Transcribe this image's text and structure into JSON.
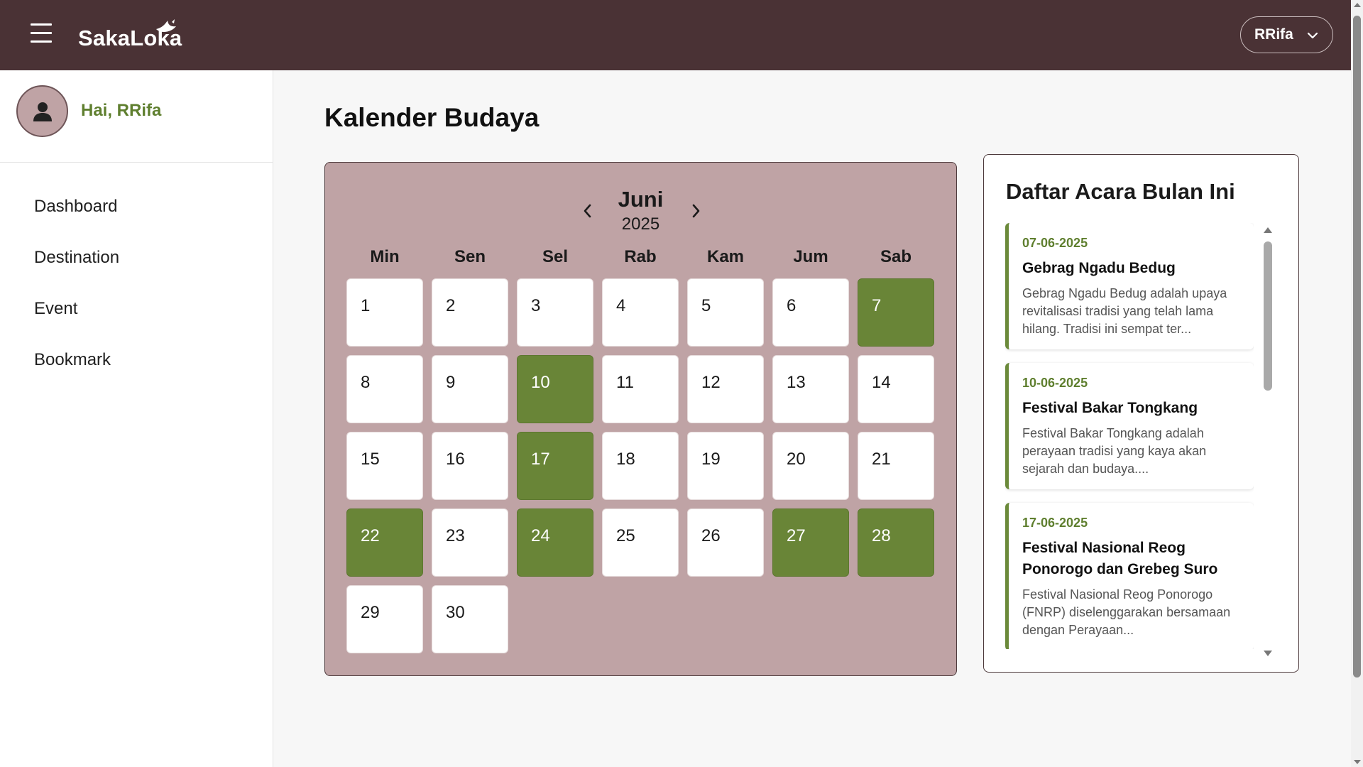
{
  "header": {
    "brand": "SakaLoka",
    "user_label": "RRifa",
    "colors": {
      "topbar": "#4a3235",
      "accent_green": "#698537",
      "calendar_bg": "#bfa3a5"
    }
  },
  "sidebar": {
    "greeting": "Hai, RRifa",
    "items": [
      {
        "label": "Dashboard"
      },
      {
        "label": "Destination"
      },
      {
        "label": "Event"
      },
      {
        "label": "Bookmark"
      }
    ]
  },
  "main": {
    "title": "Kalender Budaya",
    "calendar": {
      "month": "Juni",
      "year": "2025",
      "weekdays": [
        "Min",
        "Sen",
        "Sel",
        "Rab",
        "Kam",
        "Jum",
        "Sab"
      ],
      "first_weekday_index": 0,
      "days_in_month": 30,
      "event_days": [
        7,
        10,
        17,
        22,
        24,
        27,
        28
      ]
    },
    "events_panel": {
      "title": "Daftar Acara Bulan Ini",
      "events": [
        {
          "date": "07-06-2025",
          "name": "Gebrag Ngadu Bedug",
          "desc": "Gebrag Ngadu Bedug adalah upaya revitalisasi tradisi yang telah lama hilang. Tradisi ini sempat ter..."
        },
        {
          "date": "10-06-2025",
          "name": "Festival Bakar Tongkang",
          "desc": "Festival Bakar Tongkang adalah perayaan tradisi yang kaya akan sejarah dan budaya...."
        },
        {
          "date": "17-06-2025",
          "name": "Festival Nasional Reog Ponorogo dan Grebeg Suro",
          "desc": "Festival Nasional Reog Ponorogo (FNRP) diselenggarakan bersamaan dengan Perayaan..."
        }
      ]
    }
  }
}
